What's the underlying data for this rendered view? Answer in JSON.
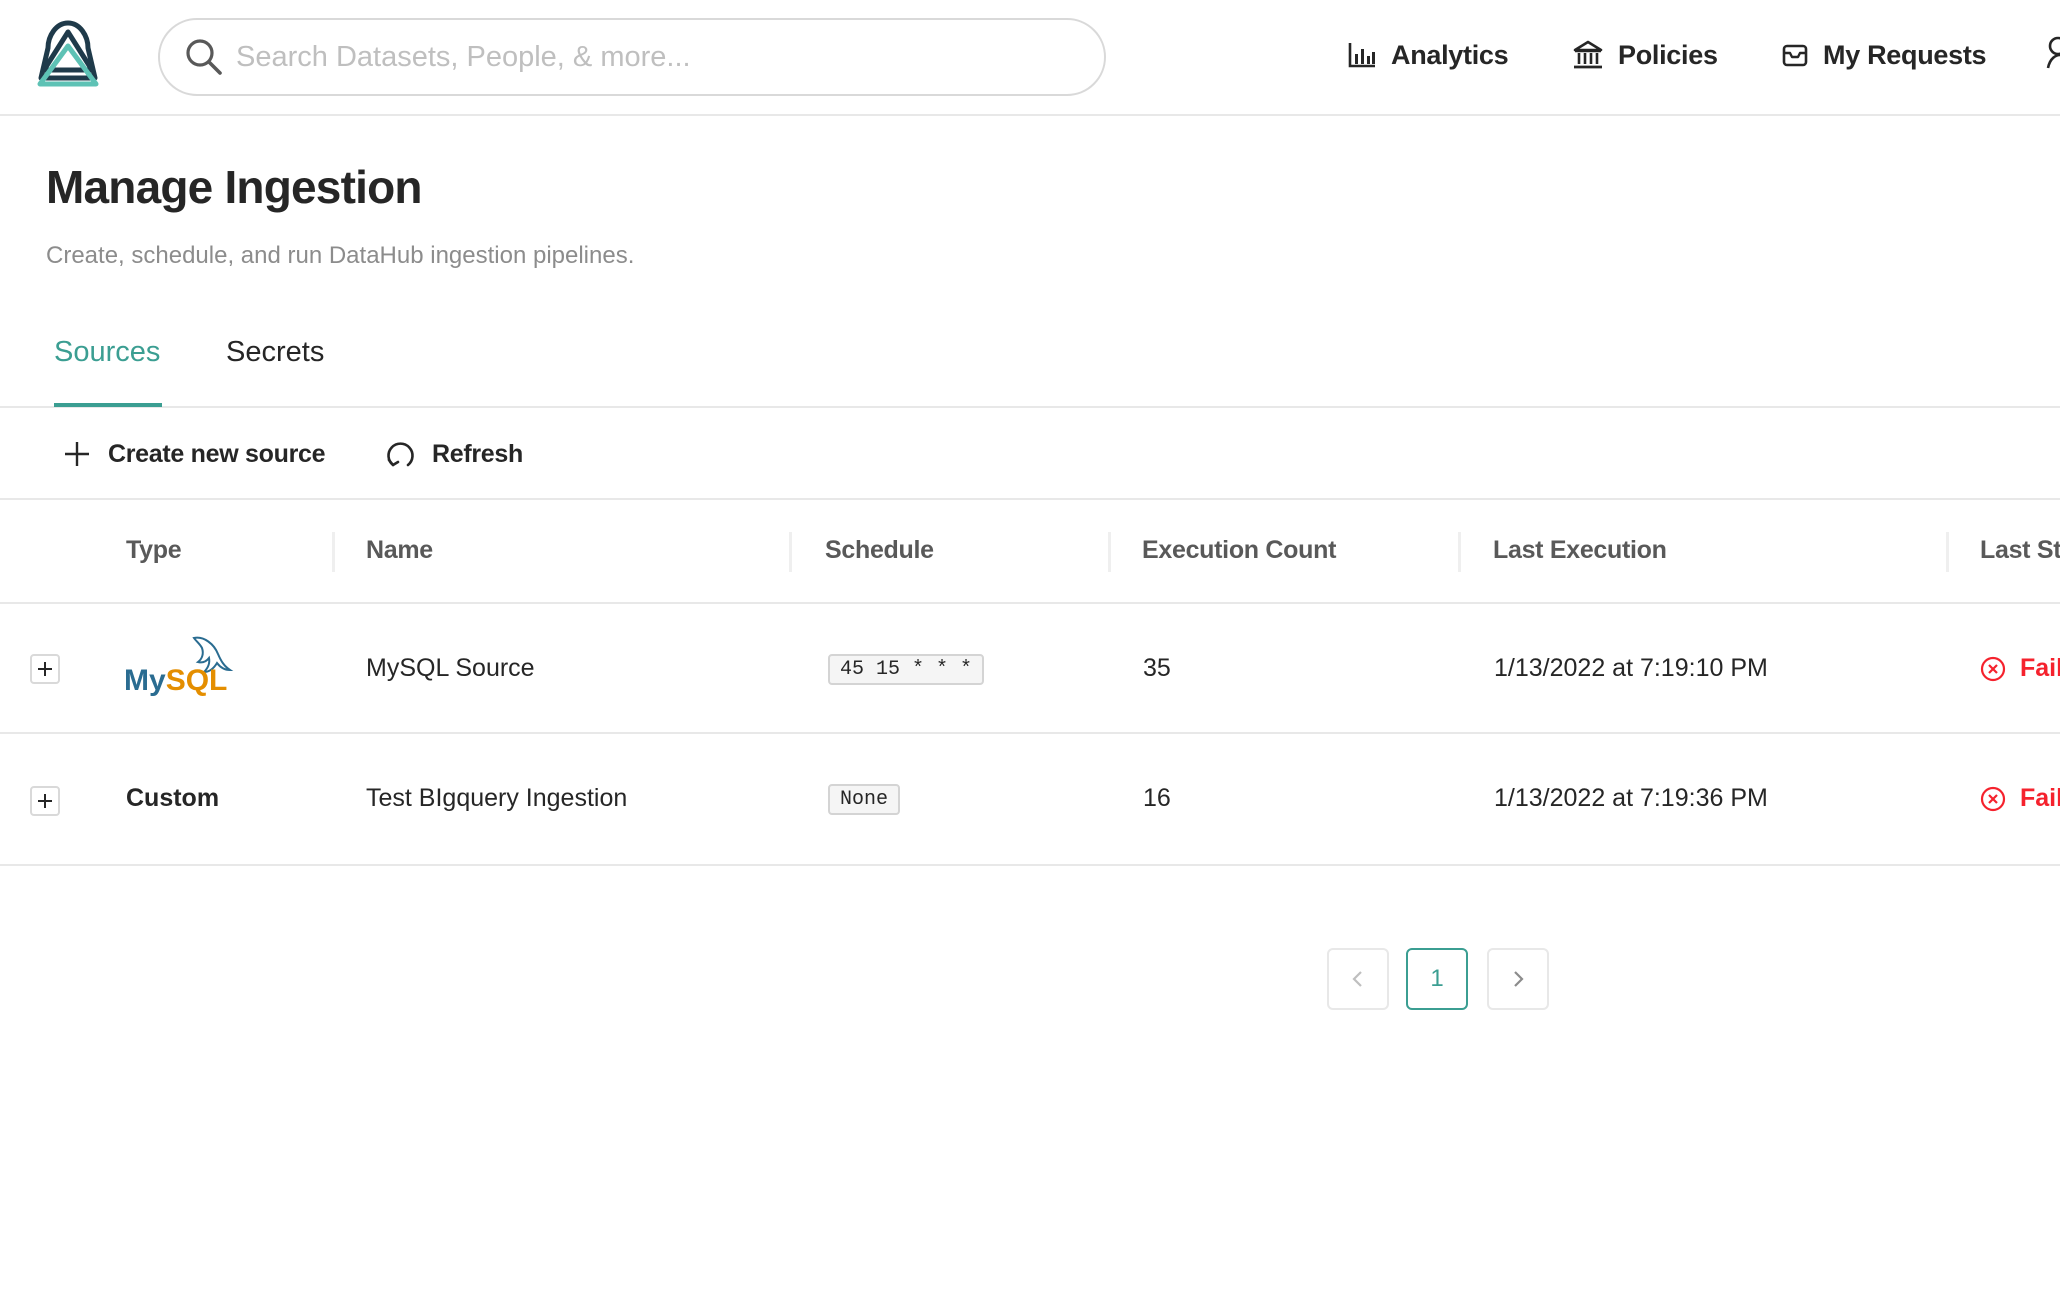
{
  "header": {
    "search_placeholder": "Search Datasets, People, & more...",
    "nav": [
      {
        "label": "Analytics",
        "icon": "bar-chart-icon"
      },
      {
        "label": "Policies",
        "icon": "bank-icon"
      },
      {
        "label": "My Requests",
        "icon": "inbox-icon"
      }
    ]
  },
  "page": {
    "title": "Manage Ingestion",
    "subtitle": "Create, schedule, and run DataHub ingestion pipelines."
  },
  "tabs": [
    {
      "label": "Sources",
      "active": true
    },
    {
      "label": "Secrets",
      "active": false
    }
  ],
  "toolbar": {
    "create_label": "Create new source",
    "refresh_label": "Refresh"
  },
  "table": {
    "columns": [
      "Type",
      "Name",
      "Schedule",
      "Execution Count",
      "Last Execution",
      "Last Sta"
    ],
    "rows": [
      {
        "type": "MySQL",
        "type_logo": true,
        "name": "MySQL Source",
        "schedule": "45 15 * * *",
        "execution_count": "35",
        "last_execution": "1/13/2022 at 7:19:10 PM",
        "last_status": "Faile"
      },
      {
        "type": "Custom",
        "type_logo": false,
        "name": "Test BIgquery Ingestion",
        "schedule": "None",
        "execution_count": "16",
        "last_execution": "1/13/2022 at 7:19:36 PM",
        "last_status": "Faile"
      }
    ]
  },
  "pagination": {
    "current_page": "1"
  },
  "colors": {
    "accent": "#3b9e92",
    "failed": "#f5222d",
    "mysql_blue": "#2a6c91",
    "mysql_orange": "#e48e00"
  }
}
